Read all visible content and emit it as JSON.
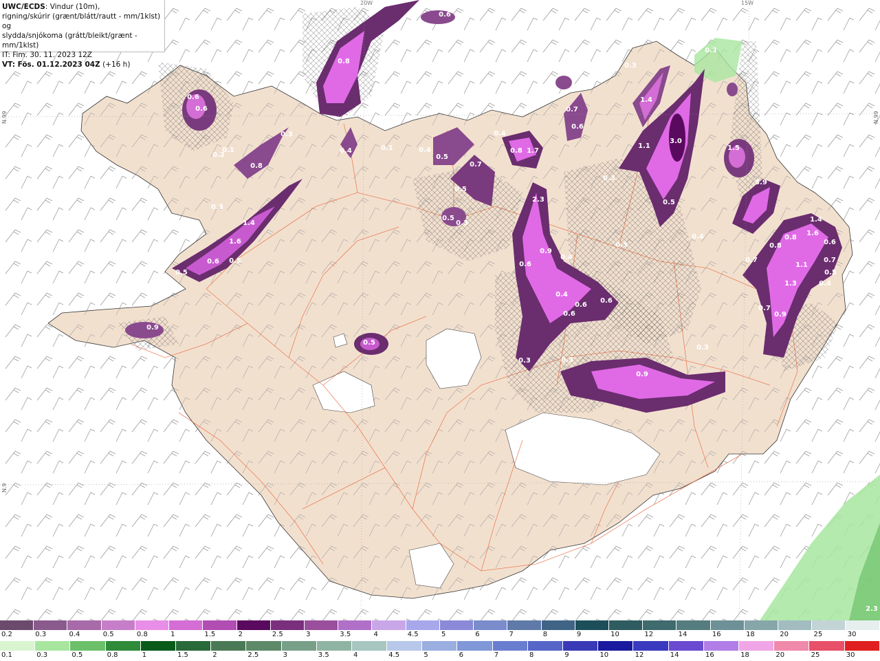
{
  "header": {
    "model": "UWC/ECDS",
    "line1_rest": ": Vindur (10m),",
    "line2": "rigning/skúrir (grænt/blátt/rautt - mm/1klst) og",
    "line3": "slydda/snjókoma (grátt/bleikt/grænt - mm/1klst)",
    "line4": "IT: Fim. 30. 11. 2023 12Z",
    "vt_label": "VT: Fös. 01.12.2023 04Z",
    "vt_lead": " (+16 h)"
  },
  "edge_labels": {
    "top_a": "20W",
    "top_b": "15W",
    "right_a": "N.99",
    "left_a": "N.99",
    "left_b": "N.9"
  },
  "colors": {
    "land": "#f2e0cf",
    "sea": "#ffffff",
    "roads": "#e8663a",
    "snow_light": "#c85ad0",
    "snow_mid": "#e06ae6",
    "snow_dark": "#6a2d6e",
    "rain_green": "#a8e6a0"
  },
  "precip_labels": [
    {
      "t": "0.8"
    },
    {
      "t": "0.6"
    },
    {
      "t": "0.6"
    },
    {
      "t": "0.6"
    },
    {
      "t": "0.3"
    },
    {
      "t": "0.8"
    },
    {
      "t": "0.2"
    },
    {
      "t": "0.1"
    },
    {
      "t": "0.3"
    },
    {
      "t": "1.4"
    },
    {
      "t": "1.6"
    },
    {
      "t": "0.6"
    },
    {
      "t": "0.5"
    },
    {
      "t": "0.5"
    },
    {
      "t": "0.9"
    },
    {
      "t": "0.5"
    },
    {
      "t": "0.4"
    },
    {
      "t": "0.1"
    },
    {
      "t": "0.4"
    },
    {
      "t": "0.5"
    },
    {
      "t": "0.5"
    },
    {
      "t": "0.7"
    },
    {
      "t": "0.5"
    },
    {
      "t": "0.4"
    },
    {
      "t": "0.8"
    },
    {
      "t": "1.7"
    },
    {
      "t": "2.3"
    },
    {
      "t": "0.6"
    },
    {
      "t": "0.9"
    },
    {
      "t": "0.4"
    },
    {
      "t": "0.4"
    },
    {
      "t": "0.6"
    },
    {
      "t": "0.6"
    },
    {
      "t": "0.6"
    },
    {
      "t": "0.3"
    },
    {
      "t": "0.3"
    },
    {
      "t": "0.9"
    },
    {
      "t": "0.7"
    },
    {
      "t": "0.6"
    },
    {
      "t": "1.4"
    },
    {
      "t": "3.0"
    },
    {
      "t": "1.1"
    },
    {
      "t": "0.5"
    },
    {
      "t": "1.5"
    },
    {
      "t": "3.9"
    },
    {
      "t": "0.3"
    },
    {
      "t": "0.3"
    },
    {
      "t": "0.3"
    },
    {
      "t": "0.4"
    },
    {
      "t": "0.8"
    },
    {
      "t": "1.6"
    },
    {
      "t": "1.4"
    },
    {
      "t": "0.8"
    },
    {
      "t": "1.1"
    },
    {
      "t": "1.3"
    },
    {
      "t": "0.7"
    },
    {
      "t": "0.5"
    },
    {
      "t": "0.7"
    },
    {
      "t": "0.4"
    },
    {
      "t": "0.7"
    },
    {
      "t": "0.9"
    },
    {
      "t": "0.3"
    },
    {
      "t": "0.3"
    },
    {
      "t": "0.6"
    },
    {
      "t": "0.3"
    },
    {
      "t": "2.3"
    }
  ],
  "legend_top": {
    "labels": [
      "0.2",
      "0.3",
      "0.4",
      "0.5",
      "0.8",
      "1",
      "1.5",
      "2",
      "2.5",
      "3",
      "3.5",
      "4",
      "4.5",
      "5",
      "6",
      "7",
      "8",
      "9",
      "10",
      "12",
      "14",
      "16",
      "18",
      "20",
      "25",
      "30"
    ],
    "colors": [
      "#6b4a6d",
      "#8a5a8d",
      "#a86aa9",
      "#c77ec9",
      "#e98ee8",
      "#d46dd5",
      "#b24db3",
      "#5a0a5e",
      "#7a2f7d",
      "#9a4f9d",
      "#b070c8",
      "#c9a6e8",
      "#a7a7ec",
      "#8a8ad8",
      "#7a8ccc",
      "#5f7aa8",
      "#3f6486",
      "#1d4f5a",
      "#2e5c60",
      "#3f6a6e",
      "#557d80",
      "#6d9196",
      "#86a6aa",
      "#a2bcc0",
      "#c2d4d6",
      "#e6eeee"
    ]
  },
  "legend_bottom": {
    "labels": [
      "0.1",
      "0.3",
      "0.5",
      "0.8",
      "1",
      "1.5",
      "2",
      "2.5",
      "3",
      "3.5",
      "4",
      "4.5",
      "5",
      "6",
      "7",
      "8",
      "9",
      "10",
      "12",
      "14",
      "16",
      "18",
      "20",
      "25",
      "30"
    ],
    "colors": [
      "#d8f5d0",
      "#a8e6a0",
      "#6cc06a",
      "#2f8a3a",
      "#0a5a1a",
      "#2a6a3a",
      "#4a7a55",
      "#5e8a6a",
      "#78a088",
      "#90b4a4",
      "#a7c6c0",
      "#b8c8ea",
      "#9aaee0",
      "#8098d8",
      "#6a7ed0",
      "#5566c8",
      "#3a3ab8",
      "#1a1aa0",
      "#3a3ac0",
      "#6a4ad0",
      "#b07ee6",
      "#f0a6e6",
      "#f08aaa",
      "#e8506a",
      "#e02020"
    ]
  }
}
